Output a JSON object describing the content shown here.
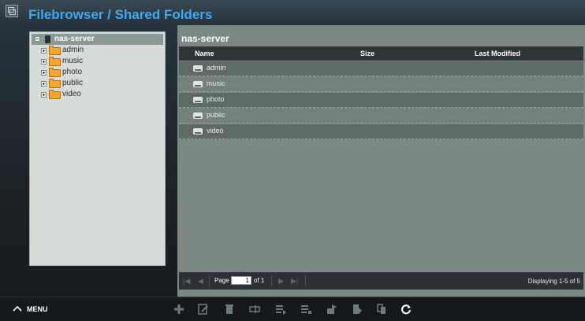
{
  "header": {
    "title": "Filebrowser / Shared Folders"
  },
  "tree": {
    "root": "nas-server",
    "items": [
      {
        "label": "admin"
      },
      {
        "label": "music"
      },
      {
        "label": "photo"
      },
      {
        "label": "public"
      },
      {
        "label": "video"
      }
    ]
  },
  "grid": {
    "path": "nas-server",
    "columns": {
      "name": "Name",
      "size": "Size",
      "modified": "Last Modified"
    },
    "rows": [
      {
        "name": "admin"
      },
      {
        "name": "music"
      },
      {
        "name": "photo"
      },
      {
        "name": "public"
      },
      {
        "name": "video"
      }
    ]
  },
  "pager": {
    "page_label": "Page",
    "page_value": "1",
    "of_label": "of 1",
    "display": "Displaying 1-5 of 5"
  },
  "bottombar": {
    "menu_label": "MENU",
    "tools": [
      "add-icon",
      "edit-icon",
      "delete-icon",
      "rename-icon",
      "move-icon",
      "copy-icon",
      "share-icon",
      "paste-icon",
      "duplicate-icon",
      "refresh-icon"
    ]
  },
  "colors": {
    "title_accent": "#3fa9f5",
    "folder": "#f0a830"
  }
}
